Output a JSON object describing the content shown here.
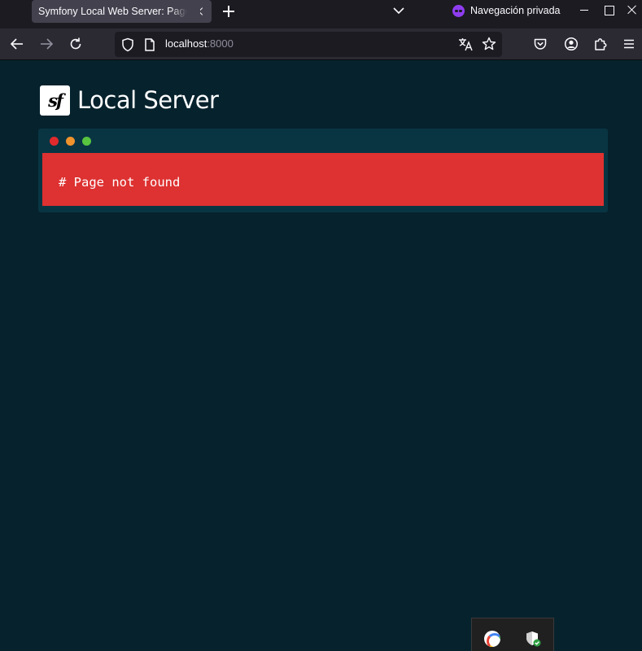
{
  "tabbar": {
    "tab_title": "Symfony Local Web Server: Page not found",
    "private_label": "Navegación privada"
  },
  "navbar": {
    "url_host": "localhost",
    "url_port": ":8000"
  },
  "page": {
    "logo_text": "sf",
    "brand_title": "Local Server",
    "error_message": "# Page not found"
  },
  "colors": {
    "page_background": "#06222d",
    "terminal_background": "#093543",
    "error_background": "#de3131",
    "dot_red": "#e22a2d",
    "dot_yellow": "#f0932d",
    "dot_green": "#58c43f",
    "private_purple": "#8f3df0"
  },
  "icons": {
    "back": "arrow-left-icon",
    "forward": "arrow-right-icon",
    "reload": "reload-icon",
    "tracking_protection": "shield-icon",
    "page_info": "page-icon",
    "translate": "translate-icon",
    "bookmark": "star-icon",
    "pocket": "pocket-icon",
    "account": "account-icon",
    "extensions": "puzzle-icon",
    "menu": "hamburger-menu-icon"
  }
}
